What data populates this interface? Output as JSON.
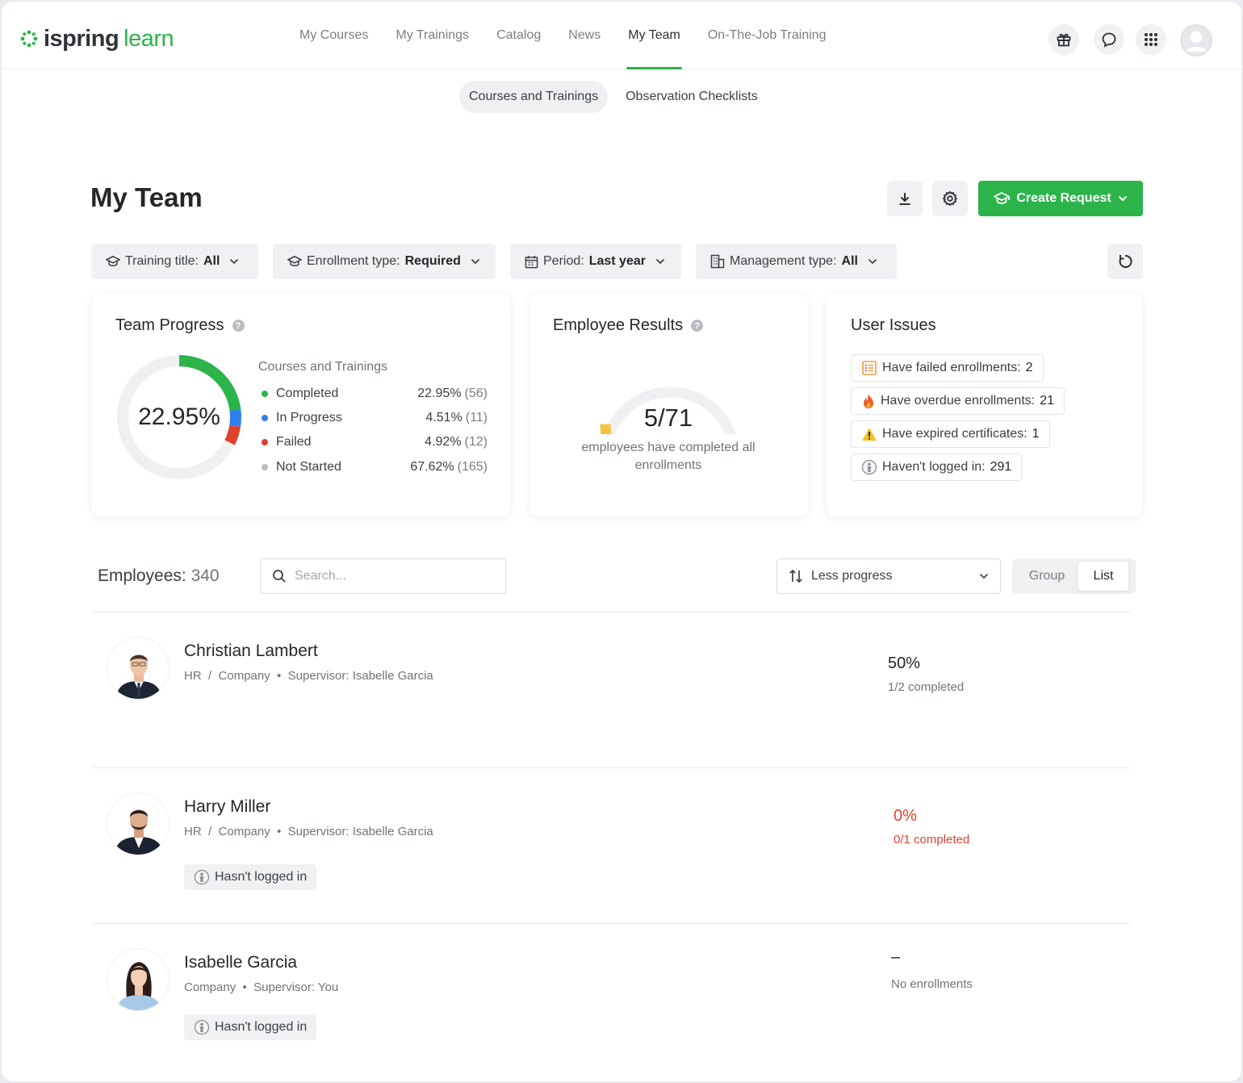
{
  "app": {
    "logo_main": "ispring",
    "logo_accent": "learn",
    "brand_color": "#2cb34a"
  },
  "nav": {
    "items": [
      {
        "label": "My Courses",
        "active": false
      },
      {
        "label": "My Trainings",
        "active": false
      },
      {
        "label": "Catalog",
        "active": false
      },
      {
        "label": "News",
        "active": false
      },
      {
        "label": "My Team",
        "active": true
      },
      {
        "label": "On-The-Job Training",
        "active": false
      }
    ],
    "icons": [
      "gift-icon",
      "chat-icon",
      "apps-grid-icon",
      "user-avatar-icon"
    ]
  },
  "subnav": {
    "tabs": [
      {
        "label": "Courses and Trainings",
        "active": true
      },
      {
        "label": "Observation Checklists",
        "active": false
      }
    ]
  },
  "header": {
    "title": "My Team",
    "create_label": "Create Request"
  },
  "filters": [
    {
      "label": "Training title:",
      "value": "All",
      "icon": "graduation-cap-icon"
    },
    {
      "label": "Enrollment type:",
      "value": "Required",
      "icon": "graduation-cap-icon"
    },
    {
      "label": "Period:",
      "value": "Last year",
      "icon": "calendar-icon"
    },
    {
      "label": "Management type:",
      "value": "All",
      "icon": "building-icon"
    }
  ],
  "team_progress": {
    "title": "Team Progress",
    "center_label": "22.95%",
    "legend_title": "Courses and Trainings",
    "rows": [
      {
        "label": "Completed",
        "pct": "22.95%",
        "count": "(56)",
        "fraction": 0.2295,
        "color": "#2cb34a"
      },
      {
        "label": "In Progress",
        "pct": "4.51%",
        "count": "(11)",
        "fraction": 0.0451,
        "color": "#2f80ed"
      },
      {
        "label": "Failed",
        "pct": "4.92%",
        "count": "(12)",
        "fraction": 0.0492,
        "color": "#e0412f"
      },
      {
        "label": "Not Started",
        "pct": "67.62%",
        "count": "(165)",
        "fraction": 0.6762,
        "color": "#eef0f2"
      }
    ]
  },
  "employee_results": {
    "title": "Employee Results",
    "value": "5/71",
    "fraction": 0.0704,
    "caption": "employees have completed all enrollments",
    "gauge_color": "#f5c242"
  },
  "user_issues": {
    "title": "User Issues",
    "items": [
      {
        "label": "Have failed enrollments:",
        "count": "2",
        "icon": "failed-list-icon"
      },
      {
        "label": "Have overdue enrollments:",
        "count": "21",
        "icon": "fire-icon"
      },
      {
        "label": "Have expired certificates:",
        "count": "1",
        "icon": "warning-icon"
      },
      {
        "label": "Haven't logged in:",
        "count": "291",
        "icon": "not-logged-in-icon"
      }
    ]
  },
  "employees": {
    "label": "Employees:",
    "count": "340",
    "search_placeholder": "Search...",
    "sort_label": "Less progress",
    "view_options": [
      {
        "label": "Group",
        "active": false
      },
      {
        "label": "List",
        "active": true
      }
    ],
    "rows": [
      {
        "name": "Christian Lambert",
        "department": "HR",
        "org": "Company",
        "supervisor": "Supervisor: Isabelle Garcia",
        "progress": "50%",
        "completed": "1/2 completed",
        "badge": "",
        "alert": false
      },
      {
        "name": "Harry Miller",
        "department": "HR",
        "org": "Company",
        "supervisor": "Supervisor: Isabelle Garcia",
        "progress": "0%",
        "completed": "0/1 completed",
        "badge": "Hasn't logged in",
        "alert": true
      },
      {
        "name": "Isabelle Garcia",
        "department": "",
        "org": "Company",
        "supervisor": "Supervisor: You",
        "progress": "–",
        "completed": "No enrollments",
        "badge": "Hasn't logged in",
        "alert": false
      }
    ]
  }
}
